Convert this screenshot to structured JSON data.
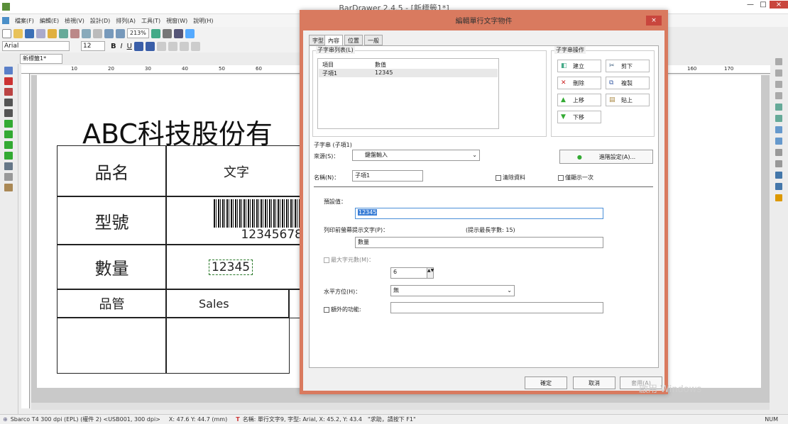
{
  "app": {
    "title": "BarDrawer 2.4.5 - [新標籤1*]",
    "window_controls": [
      "—",
      "□",
      "×"
    ]
  },
  "menubar": [
    "檔案(F)",
    "編輯(E)",
    "檢視(V)",
    "設計(D)",
    "排列(A)",
    "工具(T)",
    "視窗(W)",
    "說明(H)"
  ],
  "toolbar": {
    "zoom": "213%",
    "font": "Arial",
    "size": "12",
    "bold": "B",
    "italic": "I",
    "underline": "U"
  },
  "document_tab": "新標籤1*",
  "label": {
    "heading": "ABC科技股份有",
    "row1": {
      "label": "品名",
      "value": "文字"
    },
    "row2": {
      "label": "型號",
      "value": "12345678"
    },
    "row3": {
      "label": "數量",
      "value": "12345"
    },
    "row4": {
      "label": "品管",
      "value": "Sales"
    }
  },
  "hruler_labels": [
    "10",
    "20",
    "30",
    "40",
    "50",
    "60",
    "160",
    "170"
  ],
  "dialog": {
    "title": "編輯單行文字物件",
    "close": "×",
    "tabs": [
      "字型",
      "內容",
      "位置",
      "一般"
    ],
    "substring_group": "子字串列表(L)",
    "list_headers": [
      "項目",
      "數值"
    ],
    "list_rows": [
      {
        "item": "子項1",
        "value": "12345"
      }
    ],
    "ops_group": "子字串操作",
    "ops": [
      {
        "label": "建立",
        "icon": "new-icon"
      },
      {
        "label": "剪下",
        "icon": "cut-icon"
      },
      {
        "label": "刪除",
        "icon": "delete-icon"
      },
      {
        "label": "複製",
        "icon": "copy-icon"
      },
      {
        "label": "上移",
        "icon": "up-icon"
      },
      {
        "label": "貼上",
        "icon": "paste-icon"
      },
      {
        "label": "下移",
        "icon": "down-icon"
      }
    ],
    "sub_group": "子字串 (子項1)",
    "source_label": "來源(S)：",
    "source_value": "鍵盤輸入",
    "advanced_button": "進階設定(A)...",
    "name_label": "名稱(N)：",
    "name_value": "子項1",
    "clear_data": "清除資料",
    "show_once": "僅顯示一次",
    "default_label": "預設值：",
    "default_value": "12345",
    "prompt_label": "列印前螢幕提示文字(P)：",
    "prompt_hint": "(提示最長字數: 15)",
    "prompt_value": "數量",
    "maxchars_label": "最大字元數(M)：",
    "maxchars_value": "6",
    "align_label": "水平方位(H)：",
    "align_value": "無",
    "extra_label": "額外的功能:",
    "ok": "確定",
    "cancel": "取消",
    "apply": "套用(A)"
  },
  "status": {
    "printer": "Sbarco T4 300 dpi (EPL) (權件 2) <USB001, 300 dpi>",
    "coords": "X: 47.6 Y: 44.7 (mm)",
    "object": "名稱: 單行文字9, 字型: Arial, X: 45.2, Y: 43.4",
    "help": "\"求助，請按下 F1\"",
    "num": "NUM"
  },
  "watermark": "啟用 Windows"
}
